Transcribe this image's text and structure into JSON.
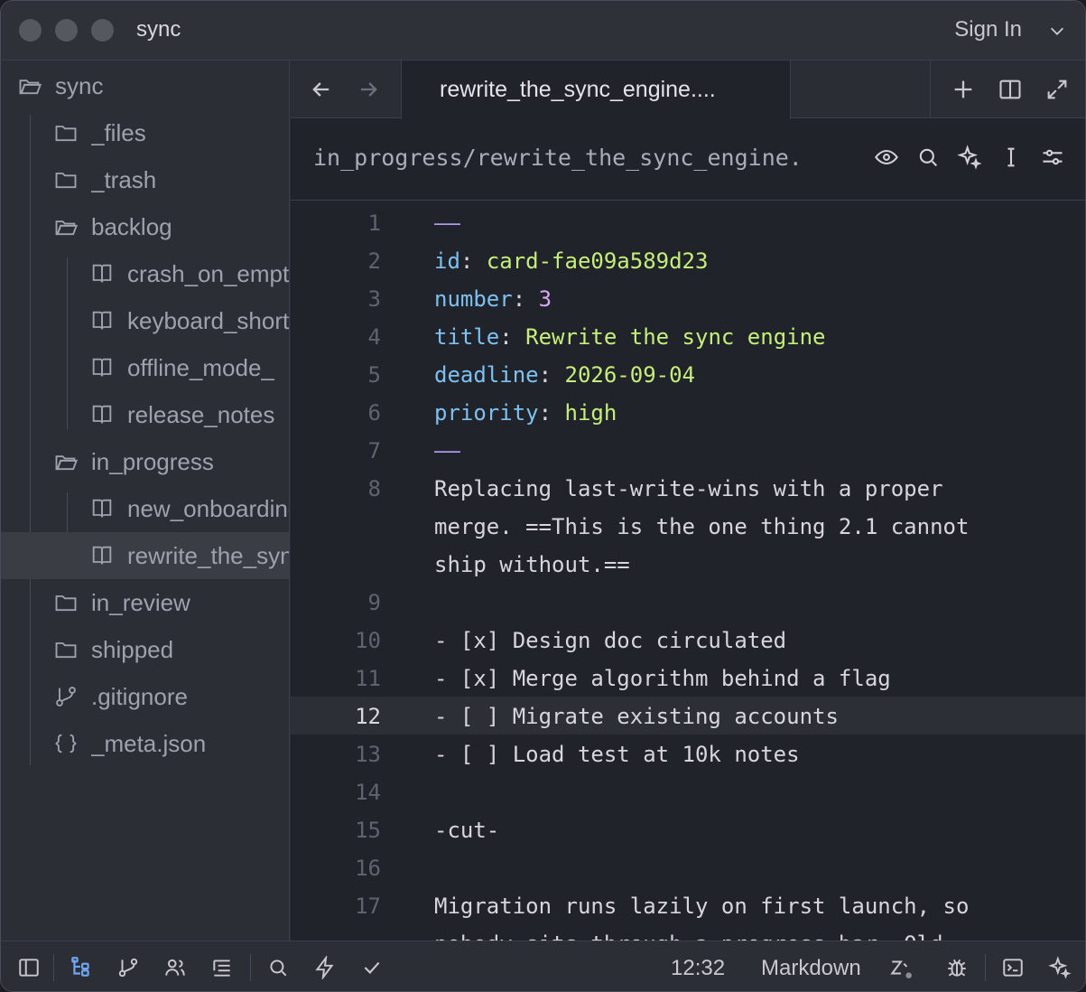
{
  "window": {
    "title": "sync",
    "signin": "Sign In"
  },
  "sidebar": {
    "root": "sync",
    "items": [
      {
        "label": "_files"
      },
      {
        "label": "_trash"
      },
      {
        "label": "backlog"
      },
      {
        "label": "crash_on_empty_note"
      },
      {
        "label": "keyboard_shortcuts"
      },
      {
        "label": "offline_mode_"
      },
      {
        "label": "release_notes"
      },
      {
        "label": "in_progress"
      },
      {
        "label": "new_onboarding"
      },
      {
        "label": "rewrite_the_sync_engine"
      },
      {
        "label": "in_review"
      },
      {
        "label": "shipped"
      },
      {
        "label": ".gitignore"
      },
      {
        "label": "_meta.json"
      }
    ]
  },
  "tab": {
    "label": "rewrite_the_sync_engine...."
  },
  "path": "in_progress/rewrite_the_sync_engine.",
  "code": {
    "ln": [
      "1",
      "2",
      "3",
      "4",
      "5",
      "6",
      "7",
      "8",
      "9",
      "10",
      "11",
      "12",
      "13",
      "14",
      "15",
      "16",
      "17"
    ],
    "dash": "——",
    "k_id": "id",
    "v_id": "card-fae09a589d23",
    "k_number": "number",
    "v_number": "3",
    "k_title": "title",
    "v_title": "Rewrite the sync engine",
    "k_deadline": "deadline",
    "v_deadline": "2026-09-04",
    "k_priority": "priority",
    "v_priority": "high",
    "colon": ": ",
    "l8a": "Replacing last-write-wins with a proper",
    "l8b": "merge. ==This is the one thing 2.1 cannot",
    "l8c": "ship without.==",
    "l10": "- [x] Design doc circulated",
    "l11": "- [x] Merge algorithm behind a flag",
    "l12": "- [ ] Migrate existing accounts",
    "l13": "- [ ] Load test at 10k notes",
    "l15": "-cut-",
    "l17": "Migration runs lazily on first launch, so",
    "l17b": "nobody sits through a progress bar. Old"
  },
  "status": {
    "time": "12:32",
    "mode": "Markdown"
  }
}
